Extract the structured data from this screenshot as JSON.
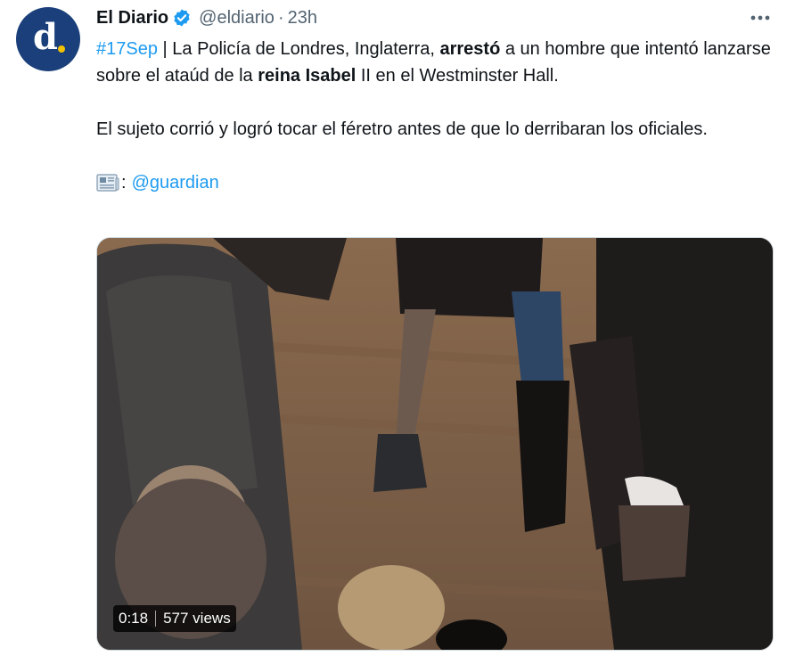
{
  "tweet": {
    "author_name": "El Diario",
    "handle": "@eldiario",
    "separator": "·",
    "time": "23h",
    "avatar_letter": "d",
    "hashtag": "#17Sep",
    "t1": " | La Policía de Londres, Inglaterra, ",
    "b1": "arrestó",
    "t2": " a un hombre que intentó lanzarse sobre el ataúd de la ",
    "b2": "reina Isabel",
    "t3": " II en el Westminster Hall.",
    "paragraph2": "El sujeto corrió y logró tocar el féretro antes de que lo derribaran los oficiales.",
    "source_prefix": ":",
    "source_mention": "@guardian"
  },
  "video": {
    "duration": "0:18",
    "views": "577 views"
  },
  "icons": {
    "verified": "verified-badge-icon",
    "more": "more-icon",
    "newspaper": "newspaper-icon"
  },
  "colors": {
    "link": "#1d9bf0",
    "verified": "#1d9bf0",
    "avatar_bg": "#1a3f7a",
    "avatar_dot": "#f2c200"
  }
}
